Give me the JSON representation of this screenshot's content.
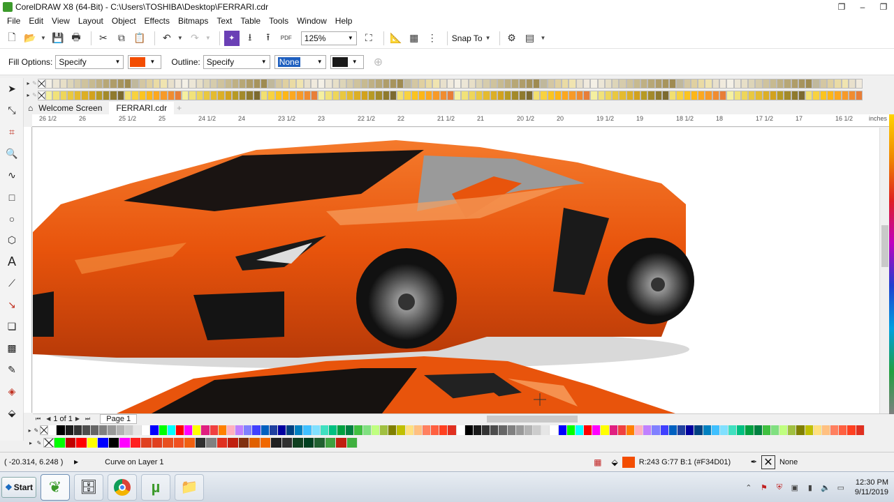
{
  "window": {
    "title": "CorelDRAW X8 (64-Bit) - C:\\Users\\TOSHIBA\\Desktop\\FERRARI.cdr"
  },
  "menu": [
    "File",
    "Edit",
    "View",
    "Layout",
    "Object",
    "Effects",
    "Bitmaps",
    "Text",
    "Table",
    "Tools",
    "Window",
    "Help"
  ],
  "toolbar": {
    "zoom_value": "125%",
    "snap_label": "Snap To"
  },
  "propbar": {
    "fill_label": "Fill Options:",
    "fill_value": "Specify",
    "fill_color": "#F34D01",
    "outline_label": "Outline:",
    "outline_value": "Specify",
    "outline_width": "None",
    "outline_color": "#1a1a1a"
  },
  "tabs": {
    "welcome": "Welcome Screen",
    "document": "FERRARI.cdr"
  },
  "ruler": {
    "labels": [
      "26 1/2",
      "26",
      "25 1/2",
      "25",
      "24 1/2",
      "24",
      "23 1/2",
      "23",
      "22 1/2",
      "22",
      "21 1/2",
      "21",
      "20 1/2",
      "20",
      "19 1/2",
      "19",
      "18 1/2",
      "18",
      "17 1/2",
      "17",
      "16 1/2"
    ],
    "unit": "inches"
  },
  "pagebar": {
    "page_count": "1 of 1",
    "page_tab": "Page 1"
  },
  "status": {
    "coordinates": "( -20.314, 6.248 )",
    "object_info": "Curve on Layer 1",
    "fill_info": "R:243 G:77 B:1 (#F34D01)",
    "outline_info": "None"
  },
  "taskbar": {
    "start_label": "Start",
    "time": "12:30 PM",
    "date": "9/11/2019"
  },
  "colors": {
    "car_orange": "#e8540c",
    "palette_top1": [
      "#f4f0e6",
      "#ece6d6",
      "#e7dfc7",
      "#ddd5b8",
      "#d6ccac",
      "#cfc39d",
      "#c7ba90",
      "#bfb083",
      "#b7a776",
      "#af9d69",
      "#a7945d",
      "#9f8b51",
      "#c0b89c",
      "#d4c7a2",
      "#e0d0a0",
      "#eadba4",
      "#f0e4b0",
      "#e8e0cc",
      "#f0eadd"
    ],
    "palette_top2": [
      "#f5f0a0",
      "#f1e27a",
      "#eed65a",
      "#e9c840",
      "#e4bb30",
      "#dcaf26",
      "#d2a21e",
      "#b79a24",
      "#a38a2a",
      "#8f7a2e",
      "#7c6a30",
      "#f2e070",
      "#f8d240",
      "#fbc420",
      "#fdb618",
      "#fca820",
      "#f79a28",
      "#f08c30",
      "#e87e38"
    ],
    "palette_bottom1": [
      "#ffffff",
      "#000000",
      "#1a1a1a",
      "#333333",
      "#4d4d4d",
      "#666666",
      "#808080",
      "#999999",
      "#b3b3b3",
      "#cccccc",
      "#e6e6e6",
      "#ffffff",
      "#0000ff",
      "#00ff00",
      "#00ffff",
      "#ff0000",
      "#ff00ff",
      "#ffff00",
      "#e02080",
      "#f04040",
      "#ff8000",
      "#ffb0c0",
      "#c080ff",
      "#8080ff",
      "#4040ff",
      "#0060c0",
      "#2040a0",
      "#0000a0",
      "#004080",
      "#0080c0",
      "#40c0ff",
      "#80e0ff",
      "#40e0c0",
      "#00c080",
      "#00a040",
      "#008040",
      "#40c040",
      "#80e080",
      "#c0ff80",
      "#a0c040",
      "#808000",
      "#c0c000",
      "#ffe080",
      "#ffc080",
      "#ff8060",
      "#ff6040",
      "#ff4020",
      "#e03020"
    ],
    "palette_bottom2": [
      "#00ff00",
      "#c00000",
      "#ff0000",
      "#ffff00",
      "#0000ff",
      "#000000",
      "#ff00ff",
      "#ff2020",
      "#e04020",
      "#e04020",
      "#e85020",
      "#f05020",
      "#f06010",
      "#303030",
      "#808080",
      "#e03020",
      "#c02010",
      "#803010",
      "#e06000",
      "#f06800",
      "#202020",
      "#303030",
      "#104020",
      "#004020",
      "#206030",
      "#40a040",
      "#c02010",
      "#40b040"
    ]
  }
}
